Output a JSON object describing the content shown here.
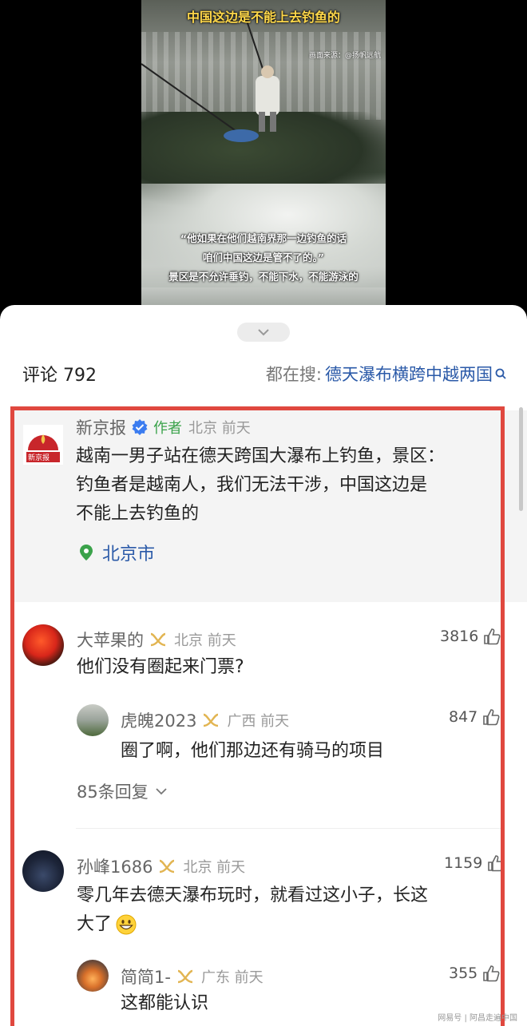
{
  "video": {
    "overlay_title_line2": "中国这边是不能上去钓鱼的",
    "source_label": "画面来源：@扬帆远航",
    "quote_line1": "“他如果在他们越南界那一边钓鱼的话",
    "quote_line2": "咱们中国这边是管不了的。”",
    "quote_line3": "景区是不允许垂钓，不能下水，不能游泳的"
  },
  "header": {
    "comment_label": "评论 792",
    "search_prefix": "都在搜:",
    "search_keyword": "德天瀑布横跨中越两国"
  },
  "author_comment": {
    "avatar_text": "新京报",
    "name": "新京报",
    "author_tag": "作者",
    "location_time": "北京 前天",
    "text_line1": "越南一男子站在德天跨国大瀑布上钓鱼，景区：",
    "text_line2": "钓鱼者是越南人，我们无法干涉，中国这边是",
    "text_line3": "不能上去钓鱼的",
    "location": "北京市"
  },
  "comments": [
    {
      "name": "大苹果的",
      "location_time": "北京 前天",
      "likes": "3816",
      "text": "他们没有圈起来门票?",
      "reply": {
        "name": "虎魄2023",
        "location_time": "广西 前天",
        "likes": "847",
        "text": "圈了啊，他们那边还有骑马的项目"
      },
      "reply_count": "85条回复"
    },
    {
      "name": "孙峰1686",
      "location_time": "北京 前天",
      "likes": "1159",
      "text_line1": "零几年去德天瀑布玩时，就看过这小子，长这",
      "text_line2": "大了",
      "reply": {
        "name": "简简1-",
        "location_time": "广东 前天",
        "likes": "355",
        "text": "这都能认识"
      }
    }
  ],
  "watermark": "网易号 | 阿昌走遍中国",
  "colors": {
    "frame_red": "#e0483f",
    "link_blue": "#2b5aa8",
    "author_green": "#3aa24a",
    "verify_blue": "#3b7cf0",
    "badge_gold": "#e2b552"
  }
}
